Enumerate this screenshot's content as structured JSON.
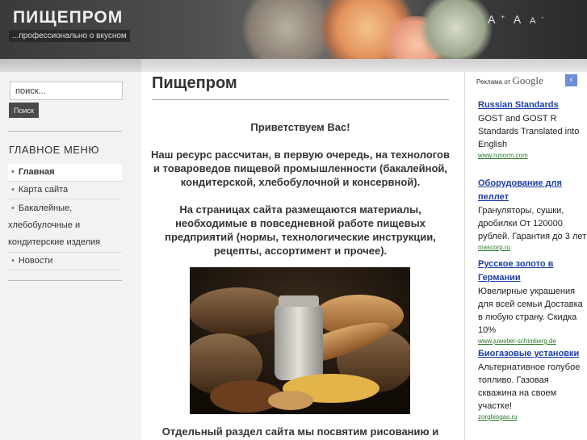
{
  "header": {
    "site_title": "ПИЩЕПРОМ",
    "slogan": "...профессионально о вкусном",
    "font_tools": {
      "increase": "A",
      "increase_mark": "+",
      "reset": "A",
      "decrease": "A",
      "decrease_mark": "-"
    }
  },
  "search": {
    "value": "поиск...",
    "button": "Поиск"
  },
  "menu": {
    "title": "ГЛАВНОЕ МЕНЮ",
    "items": [
      {
        "label": "Главная",
        "active": true
      },
      {
        "label": "Карта сайта"
      },
      {
        "label_lines": [
          "Бакалейные,",
          "хлебобулочные и",
          "кондитерские изделия"
        ]
      },
      {
        "label": "Новости"
      }
    ]
  },
  "main": {
    "title": "Пищепром",
    "greeting": "Приветствуем Вас!",
    "paragraph1": "Наш ресурс рассчитан, в первую очередь, на технологов и товароведов пищевой промышленности (бакалейной, кондитерской, хлебобулочной и консервной).",
    "paragraph2": "На страницах сайта размещаются материалы, необходимые в повседневной работе пищевых предприятий (нормы, технологические инструкции, рецепты, ассортимент и прочее).",
    "paragraph3_start": "Отдельный раздел сайта мы посвятим рисованию и"
  },
  "ads": {
    "label": "Реклама от",
    "label_brand": "Google",
    "items": [
      {
        "title": [
          "Russian Standards"
        ],
        "text": [
          "GOST and GOST R",
          "Standards Translated into",
          "English"
        ],
        "url": "www.runorm.com"
      },
      {
        "title": [
          "Оборудование для",
          "пеллет"
        ],
        "text": [
          "Грануляторы, сушки,",
          "дробилки От 120000",
          "рублей. Гарантия до 3 лет"
        ],
        "url": "mascorp.ru"
      },
      {
        "title": [
          "Русское золото в",
          "Германии"
        ],
        "text": [
          "Ювелирные украшения",
          "для всей семьи Доставка",
          "в любую страну. Скидка",
          "10%"
        ],
        "url": "www.juwelier-schimberg.de"
      },
      {
        "title": [
          "Биогазовые установки"
        ],
        "text": [
          "Альтернативное голубое",
          "топливо. Газовая",
          "скважина на своем",
          "участке!"
        ],
        "url": "zorgbiogas.ru"
      }
    ]
  },
  "colors": {
    "header_dark": "#3a3a3a",
    "link": "#1a3ea8",
    "ad_url": "#2a7a2a",
    "text": "#333333"
  }
}
